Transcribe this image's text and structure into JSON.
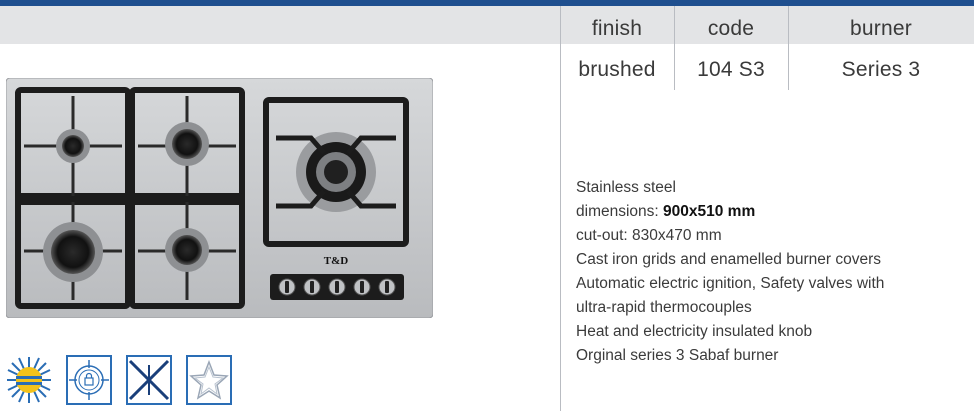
{
  "specs": {
    "headers": [
      "finish",
      "code",
      "burner"
    ],
    "values": [
      "brushed",
      "104 S3",
      "Series 3"
    ]
  },
  "description": {
    "material": "Stainless steel",
    "dimensions_label": "dimensions: ",
    "dimensions_value": "900x510 mm",
    "cutout": "cut-out: 830x470 mm",
    "grids": "Cast iron grids and enamelled burner covers",
    "ignition": "Automatic electric ignition, Safety valves with",
    "thermo": "ultra-rapid thermocouples",
    "knob": "Heat and electricity insulated knob",
    "burner": "Orginal series 3 Sabaf burner"
  },
  "hob": {
    "brand": "T&D",
    "knob_count": 5,
    "colors": {
      "steel": "#c8cacc",
      "grid": "#1c1c1c",
      "accent": "#1f4f8f"
    }
  },
  "icons": [
    "sun-icon",
    "lock-target-icon",
    "spark-icon",
    "star-icon"
  ]
}
